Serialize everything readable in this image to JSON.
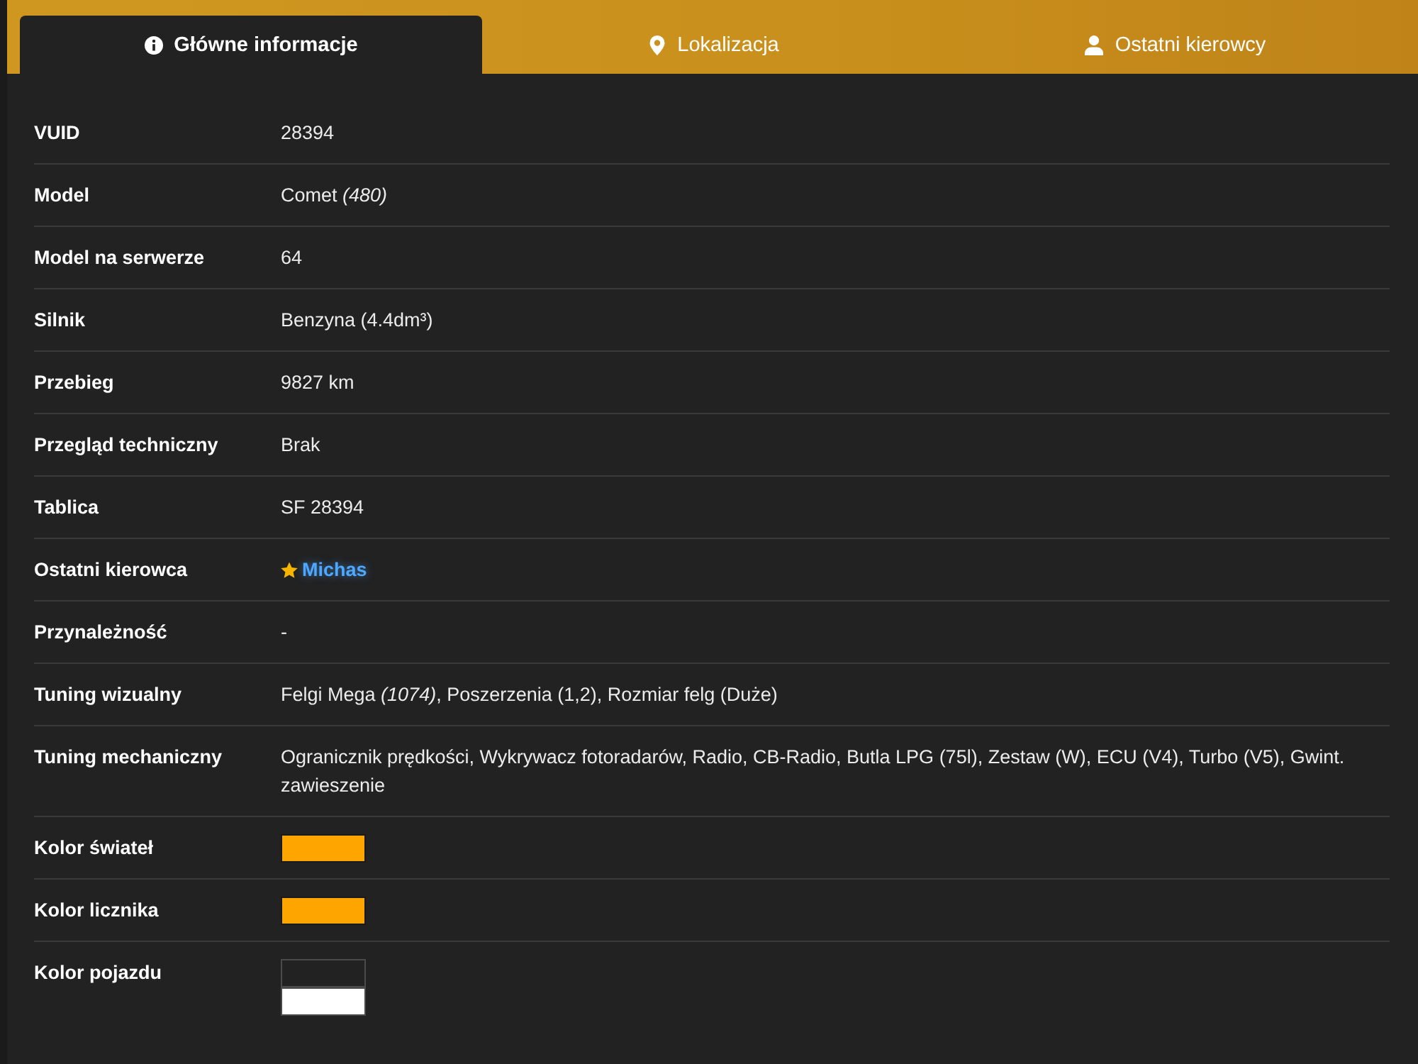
{
  "tabs": [
    {
      "label": "Główne informacje",
      "selected": true
    },
    {
      "label": "Lokalizacja",
      "selected": false
    },
    {
      "label": "Ostatni kierowcy",
      "selected": false
    }
  ],
  "rows": [
    {
      "label": "VUID",
      "kind": "text",
      "value": "28394"
    },
    {
      "label": "Model",
      "kind": "text",
      "value": "Comet *(480)*"
    },
    {
      "label": "Model na serwerze",
      "kind": "text",
      "value": "64"
    },
    {
      "label": "Silnik",
      "kind": "text",
      "value": "Benzyna (4.4dm³)"
    },
    {
      "label": "Przebieg",
      "kind": "text",
      "value": "9827 km"
    },
    {
      "label": "Przegląd techniczny",
      "kind": "text",
      "value": "Brak"
    },
    {
      "label": "Tablica",
      "kind": "text",
      "value": "SF 28394"
    },
    {
      "label": "Ostatni kierowca",
      "kind": "driver",
      "value": "Michas",
      "starred": true
    },
    {
      "label": "Przynależność",
      "kind": "text",
      "value": "-"
    },
    {
      "label": "Tuning wizualny",
      "kind": "text",
      "value": "Felgi Mega *(1074)*, Poszerzenia (1,2), Rozmiar felg (Duże)"
    },
    {
      "label": "Tuning mechaniczny",
      "kind": "text",
      "value": "Ogranicznik prędkości, Wykrywacz fotoradarów, Radio, CB-Radio, Butla LPG (75l), Zestaw (W), ECU (V4), Turbo (V5), Gwint. zawieszenie"
    },
    {
      "label": "Kolor świateł",
      "kind": "color",
      "swatches": [
        {
          "color": "#ffa500"
        }
      ]
    },
    {
      "label": "Kolor licznika",
      "kind": "color",
      "swatches": [
        {
          "color": "#ffa500"
        }
      ]
    },
    {
      "label": "Kolor pojazdu",
      "kind": "color",
      "swatches": [
        {
          "color": "#222222"
        },
        {
          "color": "#ffffff"
        }
      ]
    }
  ]
}
